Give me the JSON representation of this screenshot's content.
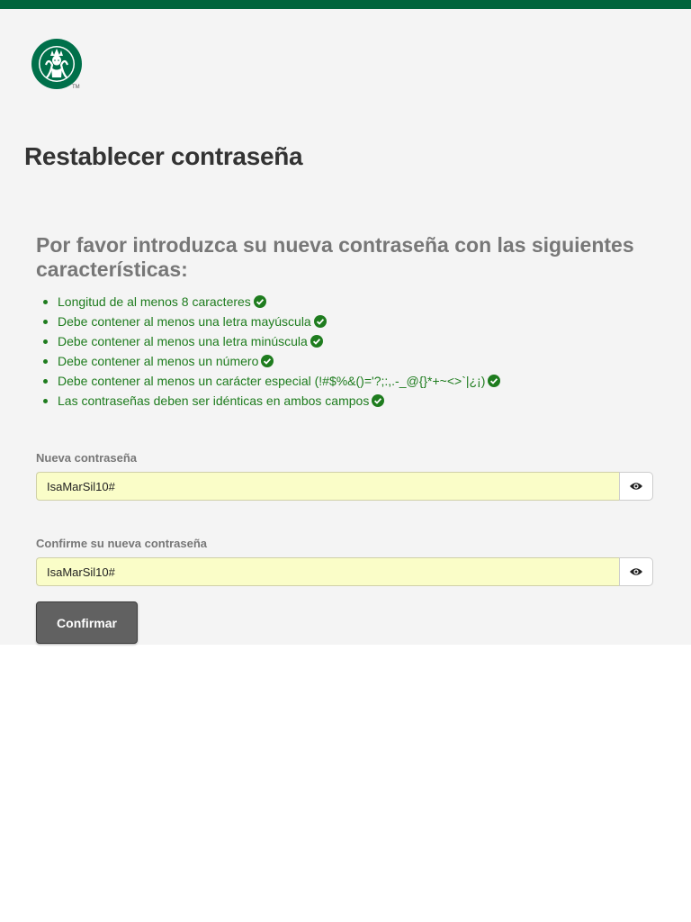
{
  "page": {
    "title": "Restablecer contraseña",
    "intro": "Por favor introduzca su nueva contraseña con las siguientes características:",
    "brand_color": "#00643c",
    "status_color": "#1e7c1e",
    "logo_icon": "starbucks-siren-logo",
    "logo_tm": "TM"
  },
  "requirements": [
    {
      "text": "Longitud de al menos 8 caracteres",
      "met": true
    },
    {
      "text": "Debe contener al menos una letra mayúscula",
      "met": true
    },
    {
      "text": "Debe contener al menos una letra minúscula",
      "met": true
    },
    {
      "text": "Debe contener al menos un número",
      "met": true
    },
    {
      "text": "Debe contener al menos un carácter especial (!#$%&()='?;:,.-_@{}*+~<>`|¿¡)",
      "met": true
    },
    {
      "text": "Las contraseñas deben ser idénticas en ambos campos",
      "met": true
    }
  ],
  "form": {
    "new_password_label": "Nueva contraseña",
    "new_password_value": "IsaMarSil10#",
    "confirm_password_label": "Confirme su nueva contraseña",
    "confirm_password_value": "IsaMarSil10#",
    "toggle_icon": "eye-icon",
    "submit_label": "Confirmar"
  }
}
